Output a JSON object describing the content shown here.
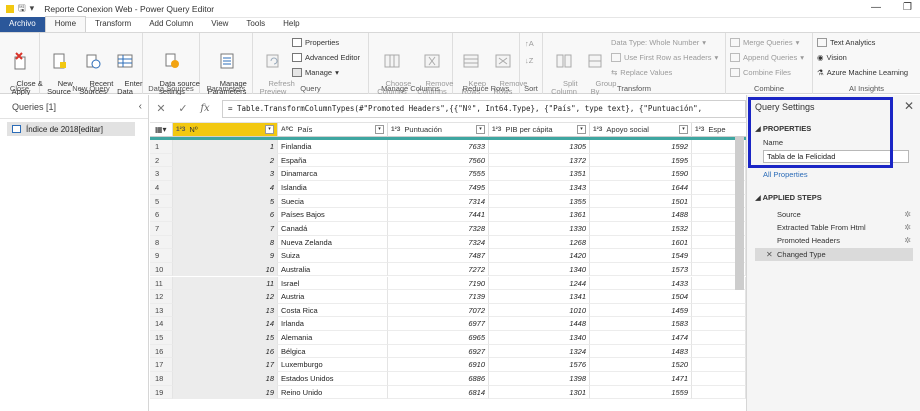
{
  "title": "Reporte Conexion Web - Power Query Editor",
  "tabs": [
    "Archivo",
    "Home",
    "Transform",
    "Add Column",
    "View",
    "Tools",
    "Help"
  ],
  "ribbon": {
    "close": {
      "close_apply": "Close &\nApply",
      "group": "Close"
    },
    "new_query": {
      "new_source": "New\nSource",
      "recent_sources": "Recent\nSources",
      "enter_data": "Enter\nData",
      "group": "New Query"
    },
    "data_sources": {
      "settings": "Data source\nsettings",
      "group": "Data Sources"
    },
    "parameters": {
      "manage": "Manage\nParameters",
      "group": "Parameters"
    },
    "query": {
      "refresh": "Refresh\nPreview",
      "properties": "Properties",
      "advanced_editor": "Advanced Editor",
      "manage": "Manage",
      "group": "Query"
    },
    "manage_columns": {
      "choose": "Choose\nColumns",
      "remove": "Remove\nColumns",
      "group": "Manage Columns"
    },
    "reduce_rows": {
      "keep": "Keep\nRows",
      "remove": "Remove\nRows",
      "group": "Reduce Rows"
    },
    "sort": {
      "group": "Sort"
    },
    "transform": {
      "split": "Split\nColumn",
      "group_by": "Group\nBy",
      "data_type": "Data Type: Whole Number",
      "first_row": "Use First Row as Headers",
      "replace": "Replace Values",
      "group": "Transform"
    },
    "combine": {
      "merge": "Merge Queries",
      "append": "Append Queries",
      "files": "Combine Files",
      "group": "Combine"
    },
    "ai": {
      "text": "Text Analytics",
      "vision": "Vision",
      "ml": "Azure Machine Learning",
      "group": "AI Insights"
    }
  },
  "queries": {
    "header": "Queries [1]",
    "item": "Índice de 2018[editar]"
  },
  "formula": "= Table.TransformColumnTypes(#\"Promoted Headers\",{{\"Nº\", Int64.Type}, {\"País\", type text}, {\"Puntuación\",",
  "columns": [
    {
      "type": "1²3",
      "name": "Nº"
    },
    {
      "type": "AᴮC",
      "name": "País"
    },
    {
      "type": "1²3",
      "name": "Puntuación"
    },
    {
      "type": "1²3",
      "name": "PIB per cápita"
    },
    {
      "type": "1²3",
      "name": "Apoyo social"
    },
    {
      "type": "1²3",
      "name": "Espe"
    }
  ],
  "rows": [
    [
      1,
      "Finlandia",
      7633,
      1305,
      1592
    ],
    [
      2,
      "España",
      7560,
      1372,
      1595
    ],
    [
      3,
      "Dinamarca",
      7555,
      1351,
      1590
    ],
    [
      4,
      "Islandia",
      7495,
      1343,
      1644
    ],
    [
      5,
      "Suecia",
      7314,
      1355,
      1501
    ],
    [
      6,
      "Países Bajos",
      7441,
      1361,
      1488
    ],
    [
      7,
      "Canadá",
      7328,
      1330,
      1532
    ],
    [
      8,
      "Nueva Zelanda",
      7324,
      1268,
      1601
    ],
    [
      9,
      "Suiza",
      7487,
      1420,
      1549
    ],
    [
      10,
      "Australia",
      7272,
      1340,
      1573
    ],
    [
      11,
      "Israel",
      7190,
      1244,
      1433
    ],
    [
      12,
      "Austria",
      7139,
      1341,
      1504
    ],
    [
      13,
      "Costa Rica",
      7072,
      1010,
      1459
    ],
    [
      14,
      "Irlanda",
      6977,
      1448,
      1583
    ],
    [
      15,
      "Alemania",
      6965,
      1340,
      1474
    ],
    [
      16,
      "Bélgica",
      6927,
      1324,
      1483
    ],
    [
      17,
      "Luxemburgo",
      6910,
      1576,
      1520
    ],
    [
      18,
      "Estados Unidos",
      6886,
      1398,
      1471
    ],
    [
      19,
      "Reino Unido",
      6814,
      1301,
      1559
    ]
  ],
  "settings": {
    "title": "Query Settings",
    "properties": "PROPERTIES",
    "name_label": "Name",
    "name_value": "Tabla de la Felicidad",
    "all_properties": "All Properties",
    "applied_steps": "APPLIED STEPS",
    "steps": [
      "Source",
      "Extracted Table From Html",
      "Promoted Headers",
      "Changed Type"
    ]
  },
  "colors": {
    "accent": "#2b579a",
    "highlight_box": "#1a25c5",
    "selected_col": "#f2c811",
    "quality_bar": "#3fa6a1"
  }
}
